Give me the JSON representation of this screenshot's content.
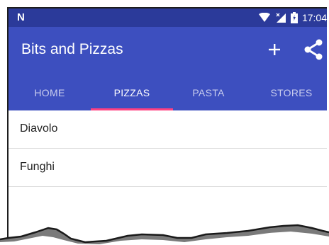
{
  "status_bar": {
    "left_icon": "notification-n-icon",
    "icons": [
      "wifi-icon",
      "signal-icon",
      "battery-icon"
    ],
    "time": "17:04"
  },
  "app_bar": {
    "title": "Bits and Pizzas",
    "actions": [
      {
        "icon": "add-icon"
      },
      {
        "icon": "share-icon"
      }
    ]
  },
  "tabs": [
    {
      "label": "HOME",
      "selected": false
    },
    {
      "label": "PIZZAS",
      "selected": true
    },
    {
      "label": "PASTA",
      "selected": false
    },
    {
      "label": "STORES",
      "selected": false
    }
  ],
  "pizzas": [
    {
      "name": "Diavolo"
    },
    {
      "name": "Funghi"
    }
  ],
  "colors": {
    "status_bar": "#2b3a9a",
    "primary": "#3d4fbf",
    "accent": "#ff4081",
    "tab_inactive": "#c9cdee"
  }
}
